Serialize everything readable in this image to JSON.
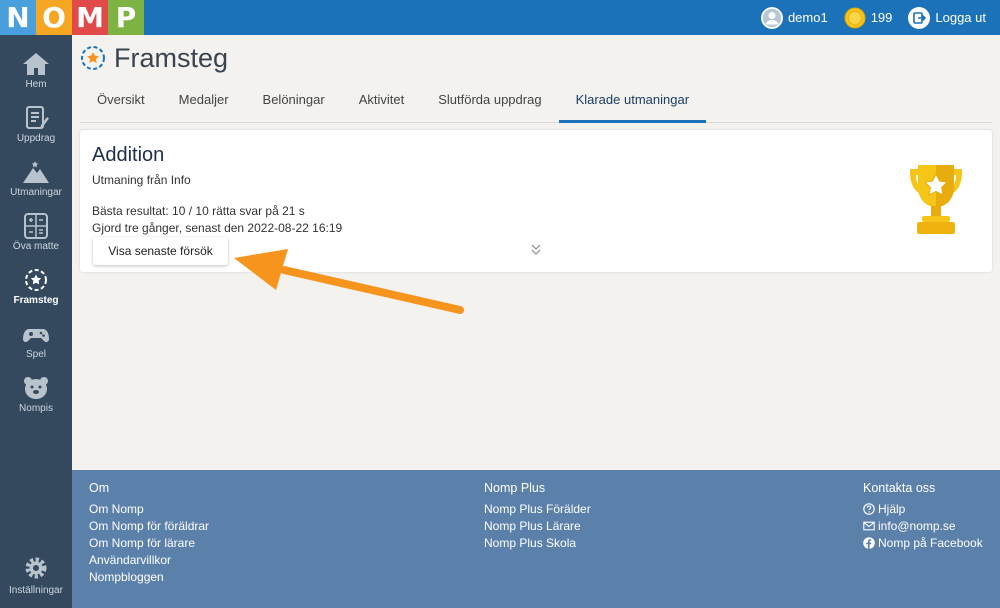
{
  "logo": {
    "letters": [
      "N",
      "O",
      "M",
      "P"
    ],
    "colors": [
      "#4aa0dc",
      "#f5a623",
      "#e24a4a",
      "#7cb342"
    ]
  },
  "topbar": {
    "username": "demo1",
    "coins": "199",
    "logout_label": "Logga ut"
  },
  "sidebar": {
    "items": [
      {
        "label": "Hem",
        "icon": "home-icon"
      },
      {
        "label": "Uppdrag",
        "icon": "assignment-icon"
      },
      {
        "label": "Utmaningar",
        "icon": "mountain-icon"
      },
      {
        "label": "Öva matte",
        "icon": "calculator-icon"
      },
      {
        "label": "Framsteg",
        "icon": "progress-star-icon",
        "active": true
      },
      {
        "label": "Spel",
        "icon": "gamepad-icon"
      },
      {
        "label": "Nompis",
        "icon": "bear-icon"
      }
    ],
    "settings_label": "Inställningar"
  },
  "page": {
    "title": "Framsteg"
  },
  "tabs": [
    {
      "label": "Översikt"
    },
    {
      "label": "Medaljer"
    },
    {
      "label": "Belöningar"
    },
    {
      "label": "Aktivitet"
    },
    {
      "label": "Slutförda uppdrag"
    },
    {
      "label": "Klarade utmaningar",
      "active": true
    }
  ],
  "card": {
    "title": "Addition",
    "subtitle": "Utmaning från Info",
    "best_result": "Bästa resultat: 10 / 10 rätta svar på 21 s",
    "done_text": "Gjord tre gånger, senast den 2022-08-22 16:19",
    "button_label": "Visa senaste försök"
  },
  "colors": {
    "topbar": "#1c72b8",
    "sidebar": "#34495e",
    "footer": "#5b80aa",
    "arrow": "#f7941d",
    "trophy": "#f5c518"
  },
  "footer": {
    "col1": {
      "heading": "Om",
      "links": [
        "Om Nomp",
        "Om Nomp för föräldrar",
        "Om Nomp för lärare",
        "Användarvillkor",
        "Nompbloggen"
      ]
    },
    "col2": {
      "heading": "Nomp Plus",
      "links": [
        "Nomp Plus Förälder",
        "Nomp Plus Lärare",
        "Nomp Plus Skola"
      ]
    },
    "col3": {
      "heading": "Kontakta oss",
      "links": [
        {
          "icon": "help-circle-icon",
          "label": "Hjälp"
        },
        {
          "icon": "envelope-icon",
          "label": "info@nomp.se"
        },
        {
          "icon": "facebook-icon",
          "label": "Nomp på Facebook"
        }
      ]
    }
  }
}
